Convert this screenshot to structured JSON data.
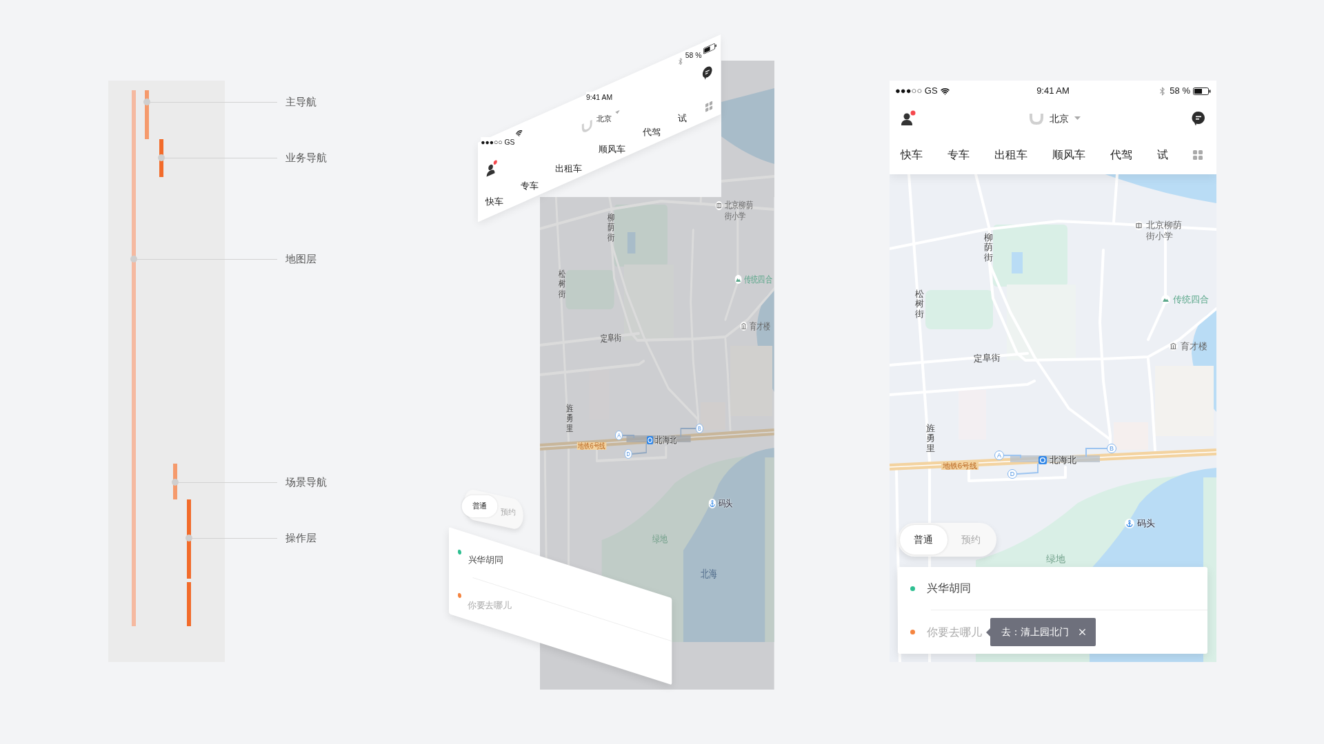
{
  "layer_legend": {
    "layers": [
      {
        "label": "主导航"
      },
      {
        "label": "业务导航"
      },
      {
        "label": "地图层"
      },
      {
        "label": "场景导航"
      },
      {
        "label": "操作层"
      }
    ]
  },
  "exploded_view": {
    "status_bar": {
      "carrier": "●●●○○ GS",
      "time": "9:41 AM",
      "battery": "58 %"
    },
    "header": {
      "city": "北京"
    },
    "service_tabs": [
      {
        "label": "快车"
      },
      {
        "label": "专车"
      },
      {
        "label": "出租车"
      },
      {
        "label": "顺风车"
      },
      {
        "label": "代驾"
      },
      {
        "label": "试"
      }
    ],
    "map": {
      "labels": [
        {
          "text": "北京柳荫街小学",
          "kind": "school"
        },
        {
          "text": "柳荫街",
          "kind": "vertical"
        },
        {
          "text": "松树街",
          "kind": "vertical"
        },
        {
          "text": "传统四合",
          "kind": "scenic"
        },
        {
          "text": "育才楼",
          "kind": "building"
        },
        {
          "text": "定阜街",
          "kind": "street"
        },
        {
          "text": "旌勇里",
          "kind": "vertical"
        },
        {
          "text": "A",
          "kind": "exit"
        },
        {
          "text": "B",
          "kind": "exit"
        },
        {
          "text": "北海北",
          "kind": "station"
        },
        {
          "text": "地铁6号线",
          "kind": "line"
        },
        {
          "text": "D",
          "kind": "exit"
        },
        {
          "text": "码头",
          "kind": "pier"
        },
        {
          "text": "绿地",
          "kind": "green"
        },
        {
          "text": "北海",
          "kind": "water"
        }
      ]
    },
    "ride_type_tabs": [
      {
        "label": "普通",
        "selected": true
      },
      {
        "label": "预约",
        "selected": false
      }
    ],
    "route_card": {
      "origin": "兴华胡同",
      "destination": {
        "placeholder": "你要去哪儿"
      }
    }
  },
  "phone": {
    "status_bar": {
      "carrier": "●●●○○ GS",
      "time": "9:41 AM",
      "battery": "58 %"
    },
    "header": {
      "city": "北京"
    },
    "service_tabs": [
      {
        "label": "快车"
      },
      {
        "label": "专车"
      },
      {
        "label": "出租车"
      },
      {
        "label": "顺风车"
      },
      {
        "label": "代驾"
      },
      {
        "label": "试"
      }
    ],
    "map": {
      "labels": [
        {
          "text": "北京柳荫街小学",
          "kind": "school"
        },
        {
          "text": "柳荫街",
          "kind": "vertical"
        },
        {
          "text": "松树街",
          "kind": "vertical"
        },
        {
          "text": "传统四合",
          "kind": "scenic"
        },
        {
          "text": "育才楼",
          "kind": "building"
        },
        {
          "text": "定阜街",
          "kind": "street"
        },
        {
          "text": "旌勇里",
          "kind": "vertical"
        },
        {
          "text": "A",
          "kind": "exit"
        },
        {
          "text": "B",
          "kind": "exit"
        },
        {
          "text": "北海北",
          "kind": "station"
        },
        {
          "text": "地铁6号线",
          "kind": "line"
        },
        {
          "text": "D",
          "kind": "exit"
        },
        {
          "text": "码头",
          "kind": "pier"
        },
        {
          "text": "绿地",
          "kind": "green"
        }
      ]
    },
    "ride_type_tabs": [
      {
        "label": "普通",
        "selected": true
      },
      {
        "label": "预约",
        "selected": false
      }
    ],
    "route_card": {
      "origin": "兴华胡同",
      "destination": {
        "placeholder": "你要去哪儿"
      },
      "destination_hint": {
        "text": "去：清上园北门"
      }
    }
  }
}
